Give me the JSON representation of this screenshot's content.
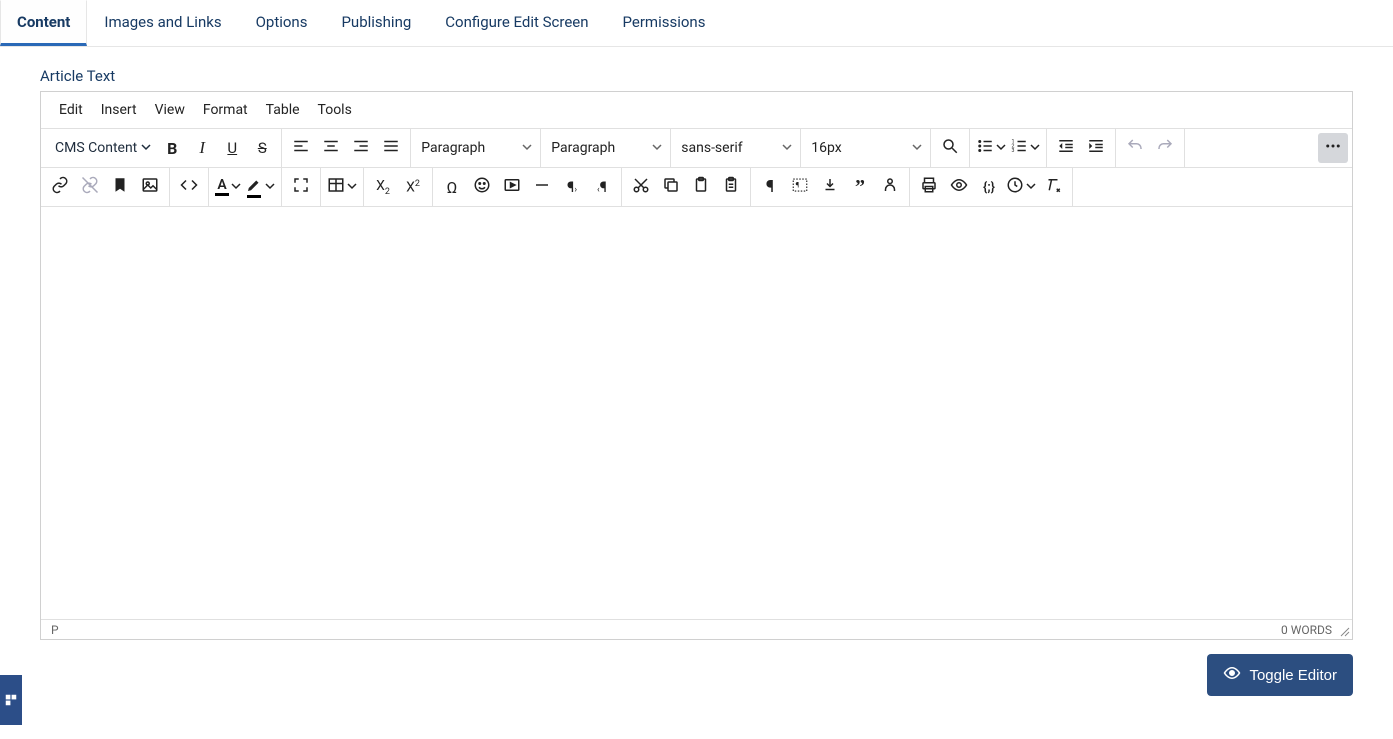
{
  "tabs": {
    "content": "Content",
    "images_links": "Images and Links",
    "options": "Options",
    "publishing": "Publishing",
    "configure": "Configure Edit Screen",
    "permissions": "Permissions"
  },
  "field_label": "Article Text",
  "menubar": {
    "edit": "Edit",
    "insert": "Insert",
    "view": "View",
    "format": "Format",
    "table": "Table",
    "tools": "Tools"
  },
  "toolbar": {
    "cms_content": "CMS Content",
    "block_format": "Paragraph",
    "style_format": "Paragraph",
    "font_family": "sans-serif",
    "font_size": "16px"
  },
  "statusbar": {
    "path": "P",
    "wordcount": "0 WORDS"
  },
  "toggle_editor": "Toggle Editor"
}
